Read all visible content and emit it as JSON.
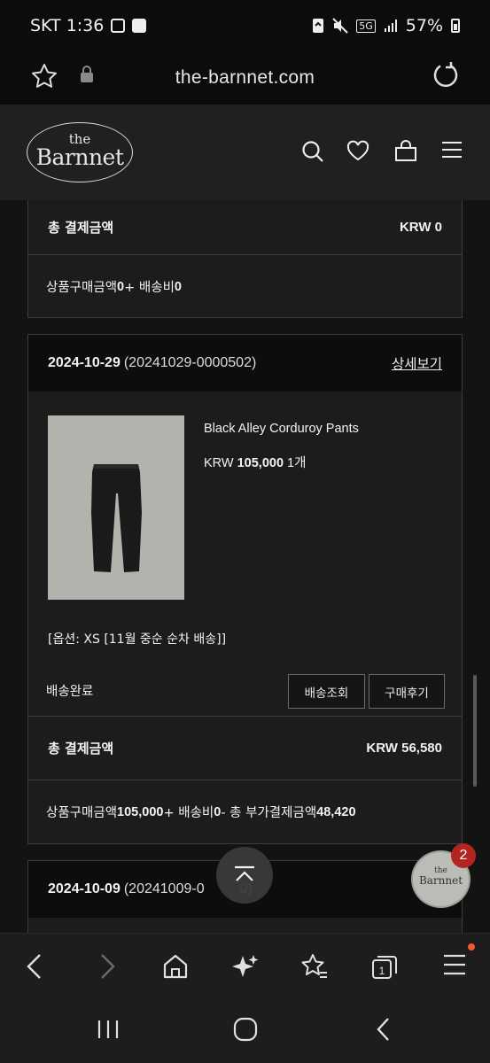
{
  "status": {
    "carrier_time": "SKT 1:36",
    "network": "5G",
    "battery": "57%"
  },
  "browser": {
    "url": "the-barnnet.com"
  },
  "site": {
    "logo_the": "the",
    "logo_name": "Barnnet"
  },
  "orders": [
    {
      "total_label": "총 결제금액",
      "total_value": "KRW 0",
      "summary_prefix": "상품구매금액 ",
      "summary_goods": "0",
      "summary_mid": " + 배송비 ",
      "summary_ship": "0"
    },
    {
      "date": "2024-10-29",
      "order_no": "(20241029-0000502)",
      "detail_label": "상세보기",
      "product_name": "Black Alley Corduroy Pants",
      "price_currency": "KRW ",
      "price_value": "105,000",
      "quantity": " 1개",
      "option": "[옵션: XS [11월 중순 순차 배송]]",
      "status": "배송완료",
      "btn_track": "배송조회",
      "btn_review": "구매후기",
      "total_label": "총 결제금액",
      "total_value": "KRW 56,580",
      "summary_prefix": "상품구매금액 ",
      "summary_goods": "105,000",
      "summary_mid": " + 배송비 ",
      "summary_ship": "0",
      "summary_extra": " - 총 부가결제금액 ",
      "summary_extra_value": "48,420"
    },
    {
      "date": "2024-10-09",
      "order_no": "(20241009-0",
      "order_no_tail": "0)",
      "detail_label": "상세"
    }
  ],
  "chat": {
    "badge_count": "2",
    "the": "the",
    "name": "Barnnet"
  },
  "colors": {
    "badge": "#b3251e",
    "notif_dot": "#ef5a2e",
    "product_bg": "#b3b3ae"
  }
}
